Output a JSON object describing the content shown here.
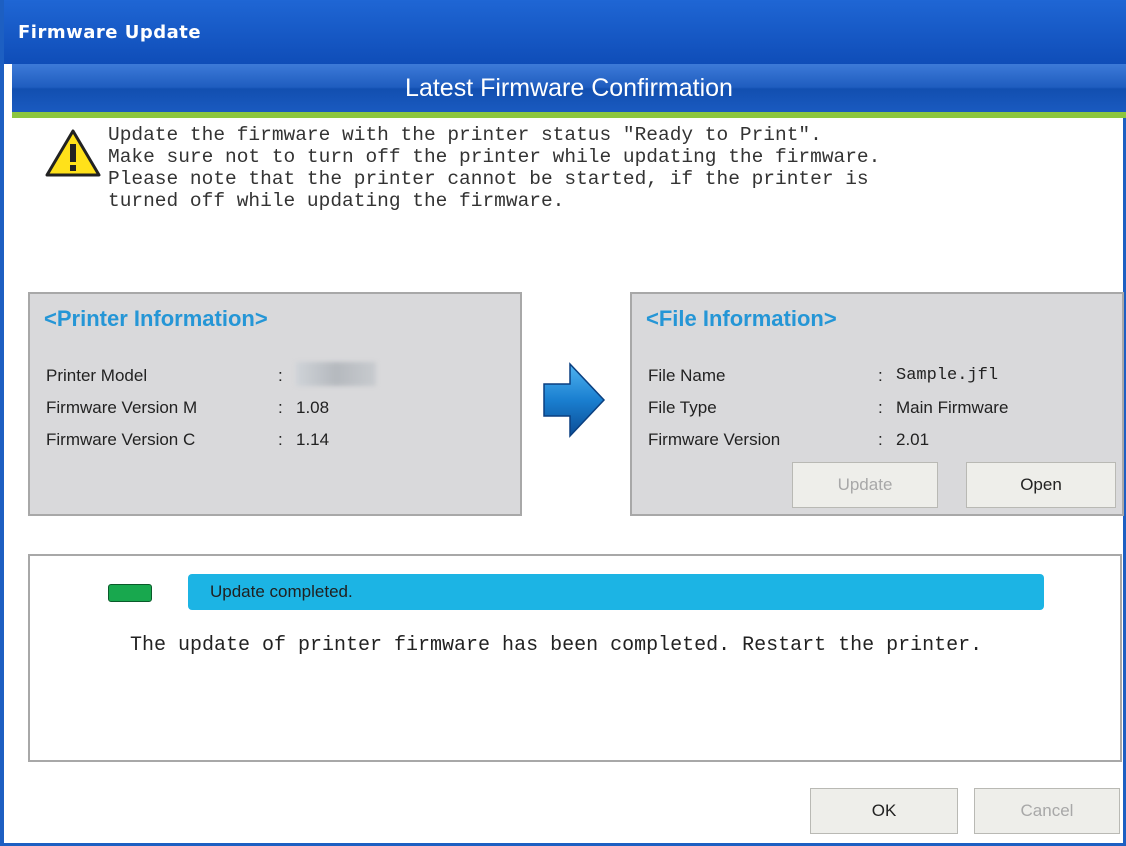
{
  "window": {
    "title": "Firmware Update"
  },
  "header": {
    "title": "Latest Firmware Confirmation"
  },
  "warning": {
    "icon": "warning-icon",
    "lines": [
      "Update the firmware with the printer status \"Ready to Print\".",
      "Make sure not to turn off the printer while updating the firmware.",
      "Please note that the printer cannot be started, if the printer is",
      "turned off while updating the firmware."
    ]
  },
  "printer_info": {
    "title": "<Printer Information>",
    "rows": [
      {
        "label": "Printer Model",
        "sep": ":",
        "value": ""
      },
      {
        "label": "Firmware Version M",
        "sep": ":",
        "value": "1.08"
      },
      {
        "label": "Firmware Version C",
        "sep": ":",
        "value": "1.14"
      }
    ]
  },
  "file_info": {
    "title": "<File Information>",
    "rows": [
      {
        "label": "File Name",
        "sep": ":",
        "value": "Sample.jfl"
      },
      {
        "label": "File Type",
        "sep": ":",
        "value": "Main Firmware"
      },
      {
        "label": "Firmware Version",
        "sep": ":",
        "value": "2.01"
      }
    ],
    "update_label": "Update",
    "open_label": "Open"
  },
  "status": {
    "text": "Update completed.",
    "message": "The update of printer firmware has been completed. Restart the printer."
  },
  "footer": {
    "ok_label": "OK",
    "cancel_label": "Cancel"
  },
  "colors": {
    "title_blue": "#1f66d4",
    "accent_green": "#8cc63f",
    "status_blue": "#1cb4e4",
    "led_green": "#18a84e",
    "section_title": "#2596d6"
  }
}
